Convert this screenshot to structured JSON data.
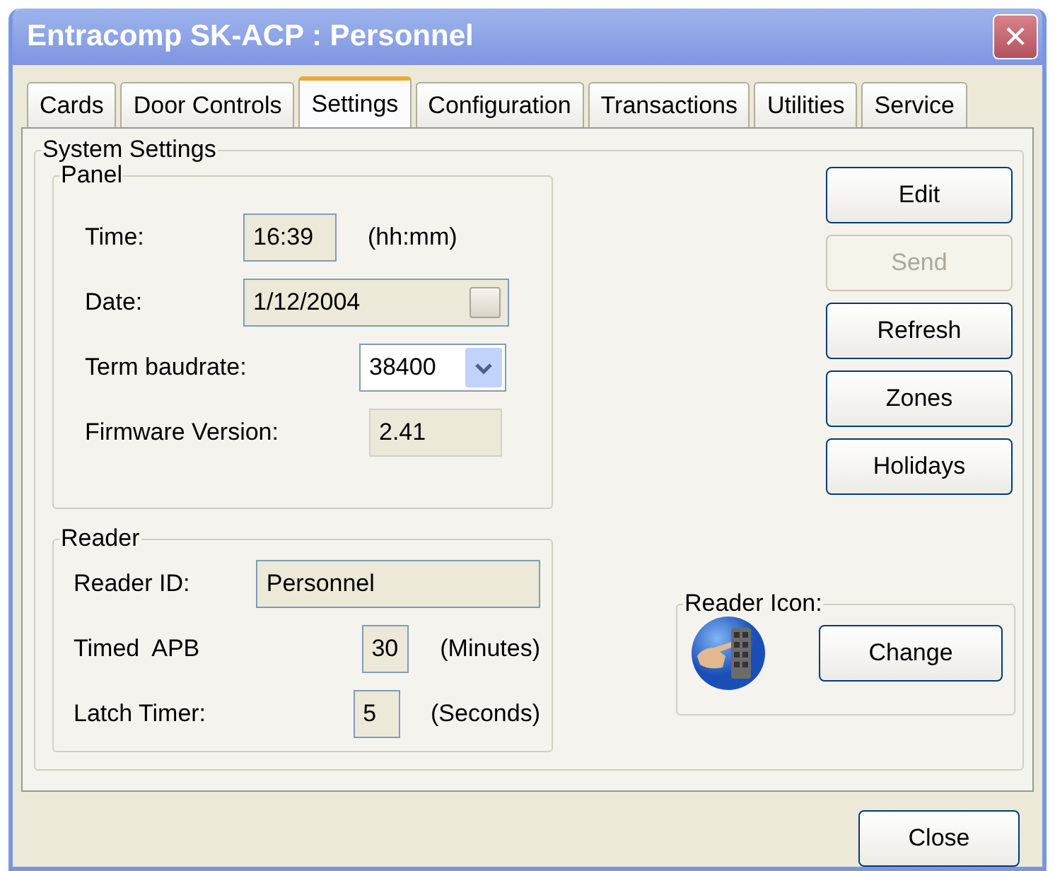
{
  "window": {
    "title": "Entracomp SK-ACP : Personnel",
    "close": "×"
  },
  "tabs": [
    {
      "label": "Cards",
      "selected": false
    },
    {
      "label": "Door Controls",
      "selected": false
    },
    {
      "label": "Settings",
      "selected": true
    },
    {
      "label": "Configuration",
      "selected": false
    },
    {
      "label": "Transactions",
      "selected": false
    },
    {
      "label": "Utilities",
      "selected": false
    },
    {
      "label": "Service",
      "selected": false
    }
  ],
  "system_settings": {
    "title": "System Settings",
    "panel": {
      "title": "Panel",
      "rows": [
        {
          "kind": "text",
          "label": "Time:",
          "value": "16:39",
          "suffix": "(hh:mm)",
          "disabled": false
        },
        {
          "kind": "date",
          "label": "Date:",
          "value": "1/12/2004",
          "disabled": false
        },
        {
          "kind": "select",
          "label": "Term baudrate:",
          "value": "38400",
          "disabled": false
        },
        {
          "kind": "text",
          "label": "Firmware Version:",
          "value": "2.41",
          "disabled": true
        }
      ]
    },
    "reader": {
      "title": "Reader",
      "rows": [
        {
          "kind": "text",
          "label": "Reader ID:",
          "value": "Personnel",
          "disabled": false
        },
        {
          "kind": "text",
          "label": "Timed  APB",
          "value": "30",
          "suffix": "(Minutes)",
          "disabled": false
        },
        {
          "kind": "text",
          "label": "Latch Timer:",
          "value": "5",
          "suffix": "(Seconds)",
          "disabled": false
        }
      ]
    },
    "buttons": [
      {
        "label": "Edit",
        "disabled": false
      },
      {
        "label": "Send",
        "disabled": true
      },
      {
        "label": "Refresh",
        "disabled": false
      },
      {
        "label": "Zones",
        "disabled": false
      },
      {
        "label": "Holidays",
        "disabled": false
      }
    ],
    "reader_icon": {
      "title": "Reader Icon:",
      "button": "Change"
    }
  },
  "footer_buttons": [
    {
      "label": "Close",
      "disabled": false
    }
  ]
}
